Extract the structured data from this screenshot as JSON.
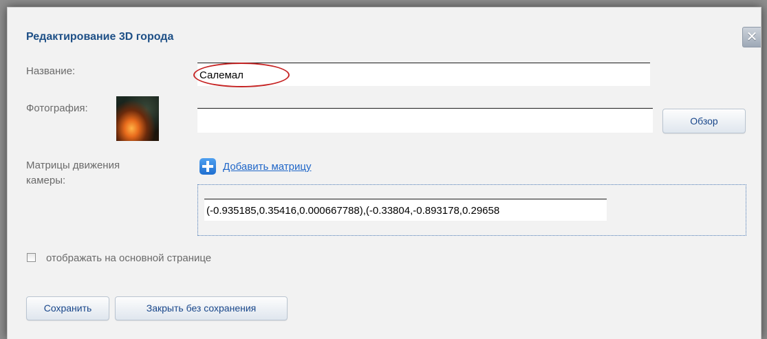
{
  "dialog": {
    "title": "Редактирование 3D города",
    "close_label": "✕"
  },
  "form": {
    "name_label": "Название:",
    "name_value": "Салемал",
    "photo_label": "Фотография:",
    "photo_value": "",
    "browse_label": "Обзор",
    "matrices_label_line1": "Матрицы движения",
    "matrices_label_line2": "камеры:",
    "add_matrix_label": "Добавить матрицу",
    "matrix_value": "(-0.935185,0.35416,0.000667788),(-0.33804,-0.893178,0.29658",
    "show_on_main_label": "отображать на основной странице",
    "show_on_main_checked": false
  },
  "footer": {
    "save_label": "Сохранить",
    "close_no_save_label": "Закрыть без сохранения"
  },
  "colors": {
    "title": "#1d4f86",
    "link": "#1f66c8",
    "highlight": "#c62424"
  },
  "icons": {
    "close": "close-icon",
    "add": "plus-icon"
  }
}
